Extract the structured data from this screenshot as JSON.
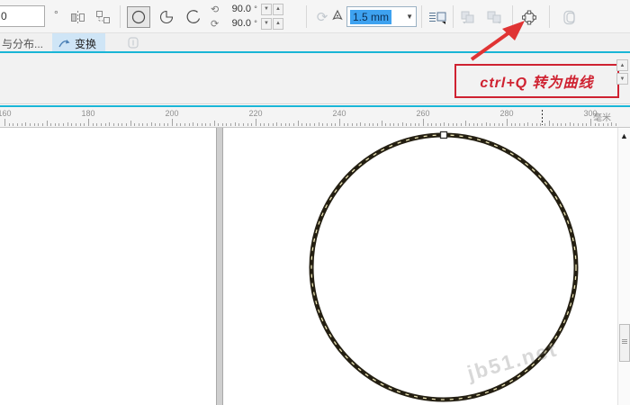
{
  "toolbar": {
    "angle_input": {
      "value": "0"
    },
    "degree_label": "°",
    "rotate_fields": [
      {
        "value": "90.0",
        "unit": "°"
      },
      {
        "value": "90.0",
        "unit": "°"
      }
    ],
    "outline_width": {
      "value": "1.5 mm"
    }
  },
  "docker": {
    "tab_left": "与分布...",
    "tab_active": "变换"
  },
  "annotation": {
    "label": "ctrl+Q 转为曲线"
  },
  "ruler": {
    "labels": [
      "160",
      "180",
      "200",
      "220",
      "240",
      "260",
      "280",
      "300"
    ],
    "unit": "毫米"
  },
  "watermark": {
    "text": "jb51.net"
  },
  "icons": {
    "rotate_ccw": "⟲",
    "rotate_cw": "⟳",
    "rotate_disabled": "⟳",
    "dropdown": "▼",
    "spin_up": "▲",
    "spin_down": "▼",
    "scroll_up": "▲"
  },
  "colors": {
    "accent_cyan": "#19b5d6",
    "annotation_red": "#cf2231",
    "selection_blue": "#3ea2f0",
    "circle_stroke": "#241f12",
    "circle_dash": "#ece5b5",
    "tab_highlight": "#cfe5f6"
  }
}
